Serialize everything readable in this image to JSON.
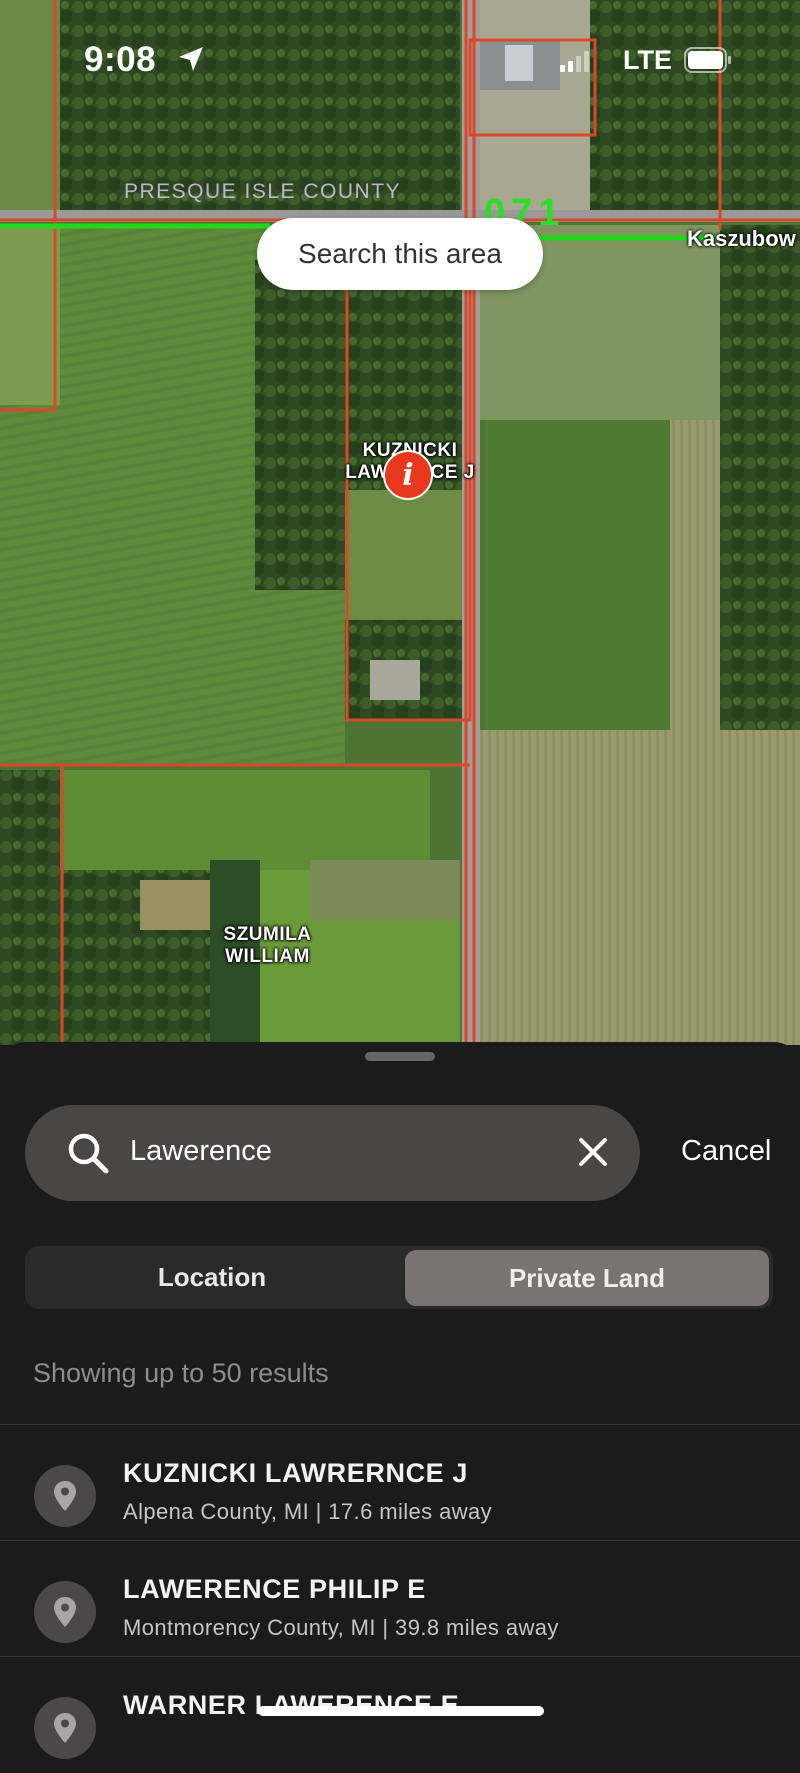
{
  "status_bar": {
    "time": "9:08",
    "carrier": "LTE"
  },
  "map": {
    "county_label": "PRESQUE ISLE COUNTY",
    "road_number": "071",
    "road_name": "Kaszubow",
    "search_area_button": "Search this area",
    "parcels": [
      {
        "label": "KUZNICKI LAWERNCE J"
      },
      {
        "label_line1": "SZUMILA",
        "label_line2": "WILLIAM"
      }
    ],
    "pin_icon": "info-pin-icon"
  },
  "sheet": {
    "search": {
      "value": "Lawerence",
      "cancel_label": "Cancel"
    },
    "tabs": [
      {
        "label": "Location",
        "selected": false
      },
      {
        "label": "Private Land",
        "selected": true
      }
    ],
    "results_caption": "Showing up to 50 results",
    "results": [
      {
        "name": "KUZNICKI LAWRERNCE J",
        "detail": "Alpena County, MI | 17.6 miles away"
      },
      {
        "name": "LAWERENCE PHILIP E",
        "detail": "Montmorency County, MI | 39.8 miles away"
      },
      {
        "name": "WARNER LAWERENCE E",
        "detail": ""
      }
    ]
  },
  "colors": {
    "accent_pin": "#e8391e",
    "parcel_line": "#d9482a",
    "road_green": "#2adf2a",
    "sheet_bg": "#1c1b1b"
  }
}
